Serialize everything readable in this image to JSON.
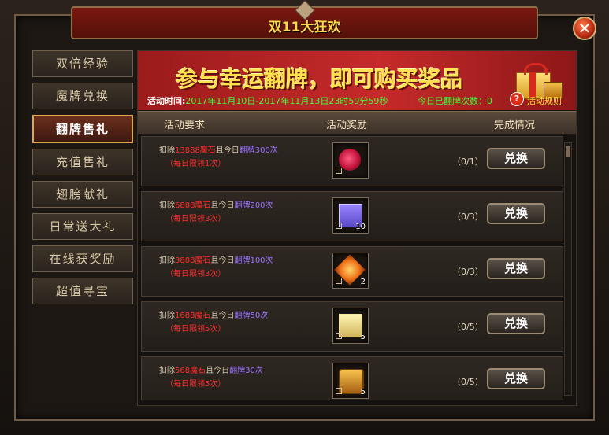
{
  "window": {
    "title": "双11大狂欢",
    "close_symbol": "✕"
  },
  "sidebar": {
    "items": [
      {
        "label": "双倍经验",
        "active": false
      },
      {
        "label": "魔牌兑换",
        "active": false
      },
      {
        "label": "翻牌售礼",
        "active": true
      },
      {
        "label": "充值售礼",
        "active": false
      },
      {
        "label": "翅膀献礼",
        "active": false
      },
      {
        "label": "日常送大礼",
        "active": false
      },
      {
        "label": "在线获奖励",
        "active": false
      },
      {
        "label": "超值寻宝",
        "active": false
      }
    ]
  },
  "banner": {
    "title": "参与幸运翻牌，即可购买奖品",
    "time_label": "活动时间:",
    "time_value": "2017年11月10日-2017年11月13日23时59分59秒",
    "today_count": "今日已翻牌次数：0",
    "rules_label": "活动规则"
  },
  "table": {
    "headers": [
      "活动要求",
      "活动奖励",
      "完成情况"
    ],
    "rows": [
      {
        "prefix": "扣除",
        "stone": "13888魔石",
        "mid": "且今日",
        "flip": "翻牌300次",
        "limit": "（每日限领1次）",
        "reward_icon": "red-orb-icon",
        "quantity": "",
        "progress": "（0/1）",
        "button": "兑换"
      },
      {
        "prefix": "扣除",
        "stone": "6888魔石",
        "mid": "且今日",
        "flip": "翻牌200次",
        "limit": "（每日限领3次）",
        "reward_icon": "purple-gift-box-icon",
        "quantity": "10",
        "progress": "（0/3）",
        "button": "兑换"
      },
      {
        "prefix": "扣除",
        "stone": "3888魔石",
        "mid": "且今日",
        "flip": "翻牌100次",
        "limit": "（每日限领3次）",
        "reward_icon": "orange-crystal-icon",
        "quantity": "2",
        "progress": "（0/3）",
        "button": "兑换"
      },
      {
        "prefix": "扣除",
        "stone": "1688魔石",
        "mid": "且今日",
        "flip": "翻牌50次",
        "limit": "（每日限领5次）",
        "reward_icon": "gold-gift-box-icon",
        "quantity": "5",
        "progress": "（0/5）",
        "button": "兑换"
      },
      {
        "prefix": "扣除",
        "stone": "568魔石",
        "mid": "且今日",
        "flip": "翻牌30次",
        "limit": "（每日限领5次）",
        "reward_icon": "treasure-chest-icon",
        "quantity": "5",
        "progress": "（0/5）",
        "button": "兑换"
      }
    ]
  }
}
